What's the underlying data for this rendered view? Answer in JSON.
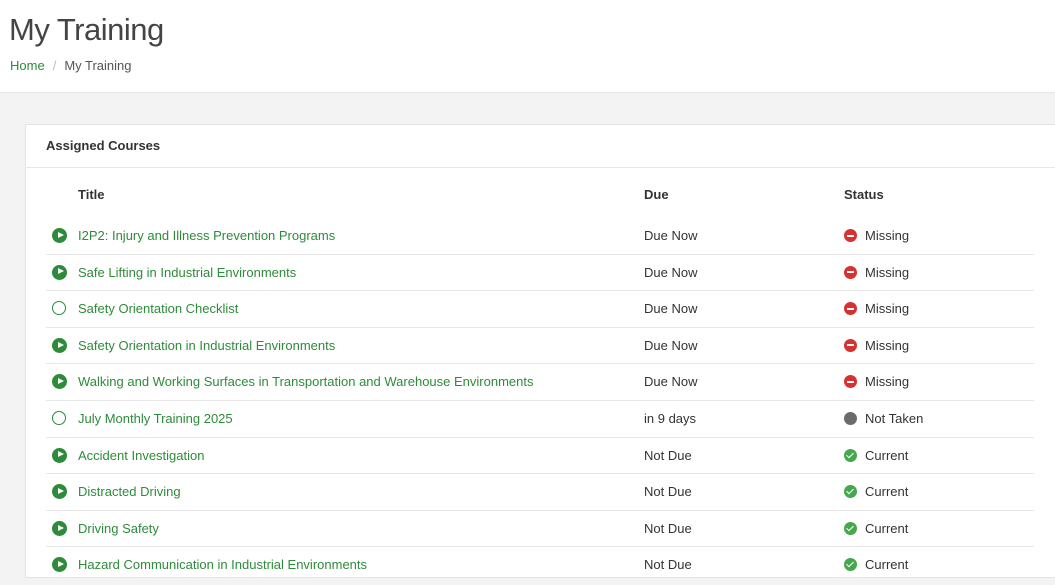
{
  "page": {
    "title": "My Training",
    "breadcrumb": {
      "home": "Home",
      "current": "My Training"
    }
  },
  "card": {
    "title": "Assigned Courses",
    "columns": {
      "title": "Title",
      "due": "Due",
      "status": "Status"
    }
  },
  "colors": {
    "accent": "#2e8b3a",
    "missing": "#d83131",
    "not_taken": "#6b6b6b",
    "current": "#45a84d"
  },
  "courses": [
    {
      "title": "I2P2: Injury and Illness Prevention Programs",
      "icon": "play-circle-icon",
      "due": "Due Now",
      "status": "Missing",
      "status_icon": "minus-circle-icon"
    },
    {
      "title": "Safe Lifting in Industrial Environments",
      "icon": "play-circle-icon",
      "due": "Due Now",
      "status": "Missing",
      "status_icon": "minus-circle-icon"
    },
    {
      "title": "Safety Orientation Checklist",
      "icon": "open-circle-icon",
      "due": "Due Now",
      "status": "Missing",
      "status_icon": "minus-circle-icon"
    },
    {
      "title": "Safety Orientation in Industrial Environments",
      "icon": "play-circle-icon",
      "due": "Due Now",
      "status": "Missing",
      "status_icon": "minus-circle-icon"
    },
    {
      "title": "Walking and Working Surfaces in Transportation and Warehouse Environments",
      "icon": "play-circle-icon",
      "due": "Due Now",
      "status": "Missing",
      "status_icon": "minus-circle-icon"
    },
    {
      "title": "July Monthly Training 2025",
      "icon": "open-circle-icon",
      "due": "in 9 days",
      "status": "Not Taken",
      "status_icon": "gray-circle-icon"
    },
    {
      "title": "Accident Investigation",
      "icon": "play-circle-icon",
      "due": "Not Due",
      "status": "Current",
      "status_icon": "check-circle-icon"
    },
    {
      "title": "Distracted Driving",
      "icon": "play-circle-icon",
      "due": "Not Due",
      "status": "Current",
      "status_icon": "check-circle-icon"
    },
    {
      "title": "Driving Safety",
      "icon": "play-circle-icon",
      "due": "Not Due",
      "status": "Current",
      "status_icon": "check-circle-icon"
    },
    {
      "title": "Hazard Communication in Industrial Environments",
      "icon": "play-circle-icon",
      "due": "Not Due",
      "status": "Current",
      "status_icon": "check-circle-icon"
    }
  ]
}
